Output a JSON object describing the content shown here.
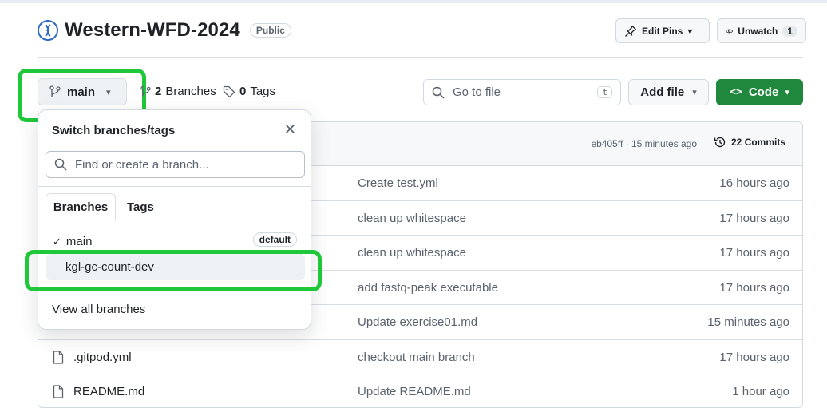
{
  "repo": {
    "name": "Western-WFD-2024",
    "visibility": "Public",
    "edit_pins_label": "Edit Pins",
    "unwatch_label": "Unwatch",
    "unwatch_count": "1"
  },
  "branch_bar": {
    "current_branch": "main",
    "branches_count": "2",
    "branches_label": "Branches",
    "tags_count": "0",
    "tags_label": "Tags",
    "goto_placeholder": "Go to file",
    "goto_shortcut": "t",
    "add_file_label": "Add file",
    "code_label": "Code"
  },
  "latest_commit": {
    "hash_time": "eb405ff · 15 minutes ago",
    "commits_label": "22 Commits"
  },
  "files": [
    {
      "name": "",
      "message": "Create test.yml",
      "age": "16 hours ago"
    },
    {
      "name": "",
      "message": "clean up whitespace",
      "age": "17 hours ago"
    },
    {
      "name": "",
      "message": "clean up whitespace",
      "age": "17 hours ago"
    },
    {
      "name": "",
      "message": "add fastq-peak executable",
      "age": "17 hours ago"
    },
    {
      "name": "",
      "message": "Update exercise01.md",
      "age": "15 minutes ago"
    },
    {
      "name": ".gitpod.yml",
      "message": "checkout main branch",
      "age": "17 hours ago"
    },
    {
      "name": "README.md",
      "message": "Update README.md",
      "age": "1 hour ago"
    }
  ],
  "dropdown": {
    "title": "Switch branches/tags",
    "search_placeholder": "Find or create a branch...",
    "tab_branches": "Branches",
    "tab_tags": "Tags",
    "branches": [
      {
        "name": "main",
        "badge": "default"
      },
      {
        "name": "kgl-gc-count-dev"
      }
    ],
    "view_all": "View all branches"
  },
  "colors": {
    "highlight": "#1ec83a",
    "code_button": "#1f883d"
  }
}
